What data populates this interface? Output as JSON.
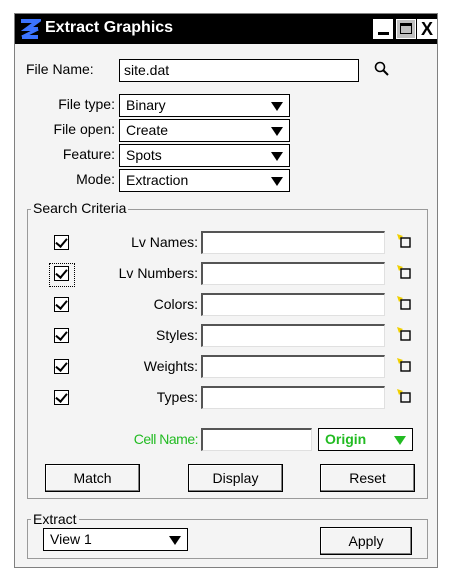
{
  "window": {
    "title": "Extract Graphics",
    "controls": {
      "minimize": "minimize",
      "maximize": "maximize",
      "close": "X"
    }
  },
  "file": {
    "name_label": "File Name:",
    "name_value": "site.dat",
    "search_icon": "magnifier-icon"
  },
  "options": [
    {
      "label": "File type:",
      "value": "Binary"
    },
    {
      "label": "File open:",
      "value": "Create"
    },
    {
      "label": "Feature:",
      "value": "Spots"
    },
    {
      "label": "Mode:",
      "value": "Extraction"
    }
  ],
  "search_criteria": {
    "group_label": "Search Criteria",
    "rows": [
      {
        "label": "Lv Names:",
        "checked": true,
        "value": ""
      },
      {
        "label": "Lv Numbers:",
        "checked": true,
        "value": ""
      },
      {
        "label": "Colors:",
        "checked": true,
        "value": ""
      },
      {
        "label": "Styles:",
        "checked": true,
        "value": ""
      },
      {
        "label": "Weights:",
        "checked": true,
        "value": ""
      },
      {
        "label": "Types:",
        "checked": true,
        "value": ""
      }
    ],
    "cell_name_label": "Cell Name:",
    "cell_name_value": "",
    "cell_mode": "Origin",
    "accent_color": "#22bb22",
    "buttons": {
      "match": "Match",
      "display": "Display",
      "reset": "Reset"
    }
  },
  "extract": {
    "group_label": "Extract",
    "view": "View 1",
    "apply": "Apply"
  }
}
